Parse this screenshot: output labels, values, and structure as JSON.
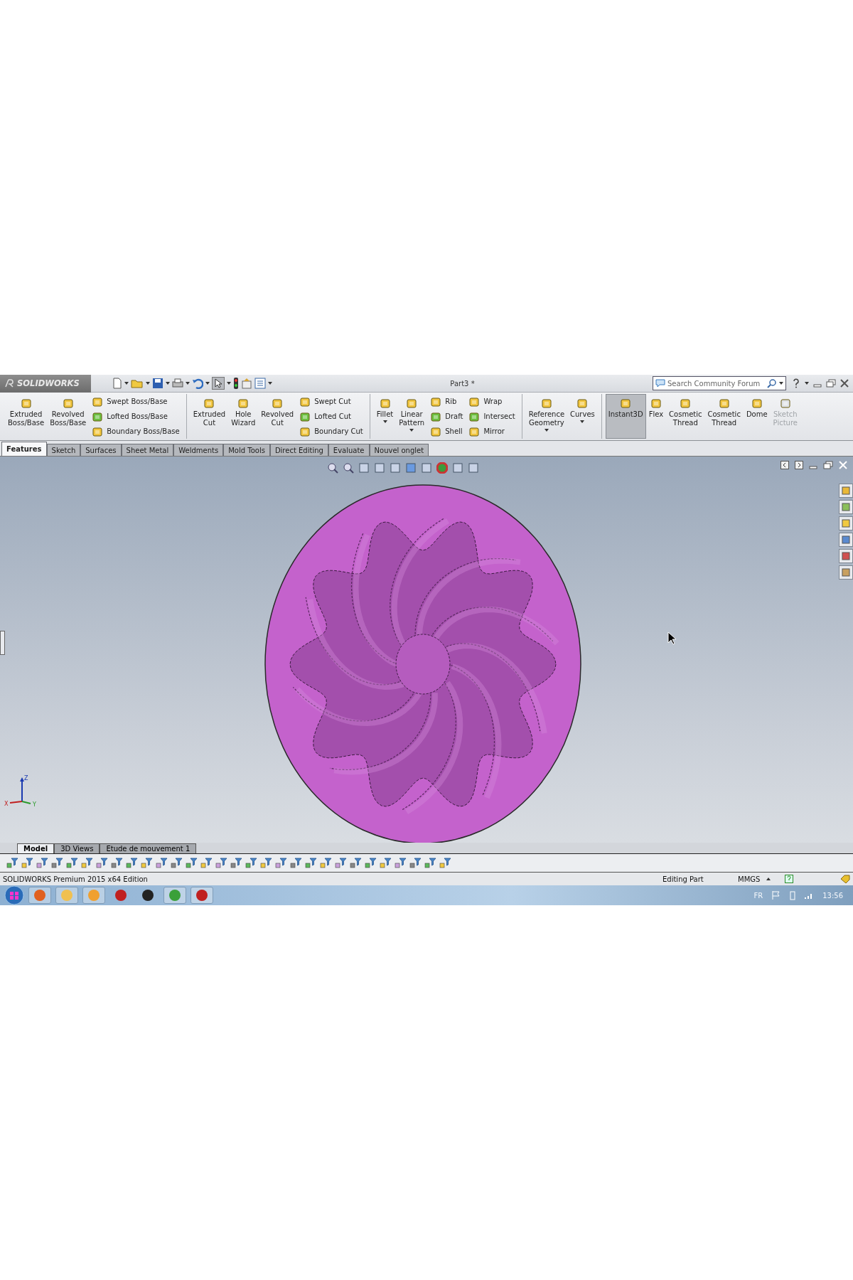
{
  "title_bar": {
    "logo": "SOLIDWORKS",
    "document_title": "Part3 *",
    "search": {
      "placeholder": "Search Community Forum"
    }
  },
  "command_groups": [
    {
      "items": [
        {
          "kind": "large",
          "label": "Extruded\nBoss/Base",
          "dropdown": false,
          "on": false,
          "disabled": false
        },
        {
          "kind": "large",
          "label": "Revolved\nBoss/Base",
          "dropdown": false,
          "on": false,
          "disabled": false
        },
        {
          "kind": "stack",
          "entries": [
            "Swept Boss/Base",
            "Lofted Boss/Base",
            "Boundary Boss/Base"
          ]
        }
      ]
    },
    {
      "items": [
        {
          "kind": "large",
          "label": "Extruded\nCut",
          "dropdown": false,
          "on": false,
          "disabled": false
        },
        {
          "kind": "large",
          "label": "Hole\nWizard",
          "dropdown": false,
          "on": false,
          "disabled": false
        },
        {
          "kind": "large",
          "label": "Revolved\nCut",
          "dropdown": false,
          "on": false,
          "disabled": false
        },
        {
          "kind": "stack",
          "entries": [
            "Swept Cut",
            "Lofted Cut",
            "Boundary Cut"
          ]
        }
      ]
    },
    {
      "items": [
        {
          "kind": "large",
          "label": "Fillet",
          "dropdown": true,
          "on": false,
          "disabled": false
        },
        {
          "kind": "large",
          "label": "Linear\nPattern",
          "dropdown": true,
          "on": false,
          "disabled": false
        },
        {
          "kind": "stack",
          "entries": [
            "Rib",
            "Draft",
            "Shell"
          ]
        },
        {
          "kind": "stack",
          "entries": [
            "Wrap",
            "Intersect",
            "Mirror"
          ]
        }
      ]
    },
    {
      "items": [
        {
          "kind": "large",
          "label": "Reference\nGeometry",
          "dropdown": true,
          "on": false,
          "disabled": false
        },
        {
          "kind": "large",
          "label": "Curves",
          "dropdown": true,
          "on": false,
          "disabled": false
        }
      ]
    },
    {
      "items": [
        {
          "kind": "large",
          "label": "Instant3D",
          "dropdown": false,
          "on": true,
          "disabled": false
        },
        {
          "kind": "large",
          "label": "Flex",
          "dropdown": false,
          "on": false,
          "disabled": false
        },
        {
          "kind": "large",
          "label": "Cosmetic\nThread",
          "dropdown": false,
          "on": false,
          "disabled": false
        },
        {
          "kind": "large",
          "label": "Cosmetic\nThread",
          "dropdown": false,
          "on": false,
          "disabled": false
        },
        {
          "kind": "large",
          "label": "Dome",
          "dropdown": false,
          "on": false,
          "disabled": false
        },
        {
          "kind": "large",
          "label": "Sketch\nPicture",
          "dropdown": false,
          "on": false,
          "disabled": true
        }
      ]
    }
  ],
  "tabs": [
    {
      "label": "Features",
      "selected": true
    },
    {
      "label": "Sketch",
      "selected": false
    },
    {
      "label": "Surfaces",
      "selected": false
    },
    {
      "label": "Sheet Metal",
      "selected": false
    },
    {
      "label": "Weldments",
      "selected": false
    },
    {
      "label": "Mold Tools",
      "selected": false
    },
    {
      "label": "Direct Editing",
      "selected": false
    },
    {
      "label": "Evaluate",
      "selected": false
    },
    {
      "label": "Nouvel onglet",
      "selected": false
    }
  ],
  "viewport": {
    "triad": {
      "x": "X",
      "y": "Y",
      "z": "Z"
    }
  },
  "bottom_tabs": [
    {
      "label": "Model",
      "selected": true
    },
    {
      "label": "3D Views",
      "selected": false
    },
    {
      "label": "Etude de mouvement 1",
      "selected": false
    }
  ],
  "status_bar": {
    "product": "SOLIDWORKS Premium 2015 x64 Edition",
    "mode": "Editing Part",
    "units": "MMGS"
  },
  "taskbar": {
    "language": "FR",
    "time": "13:56"
  }
}
